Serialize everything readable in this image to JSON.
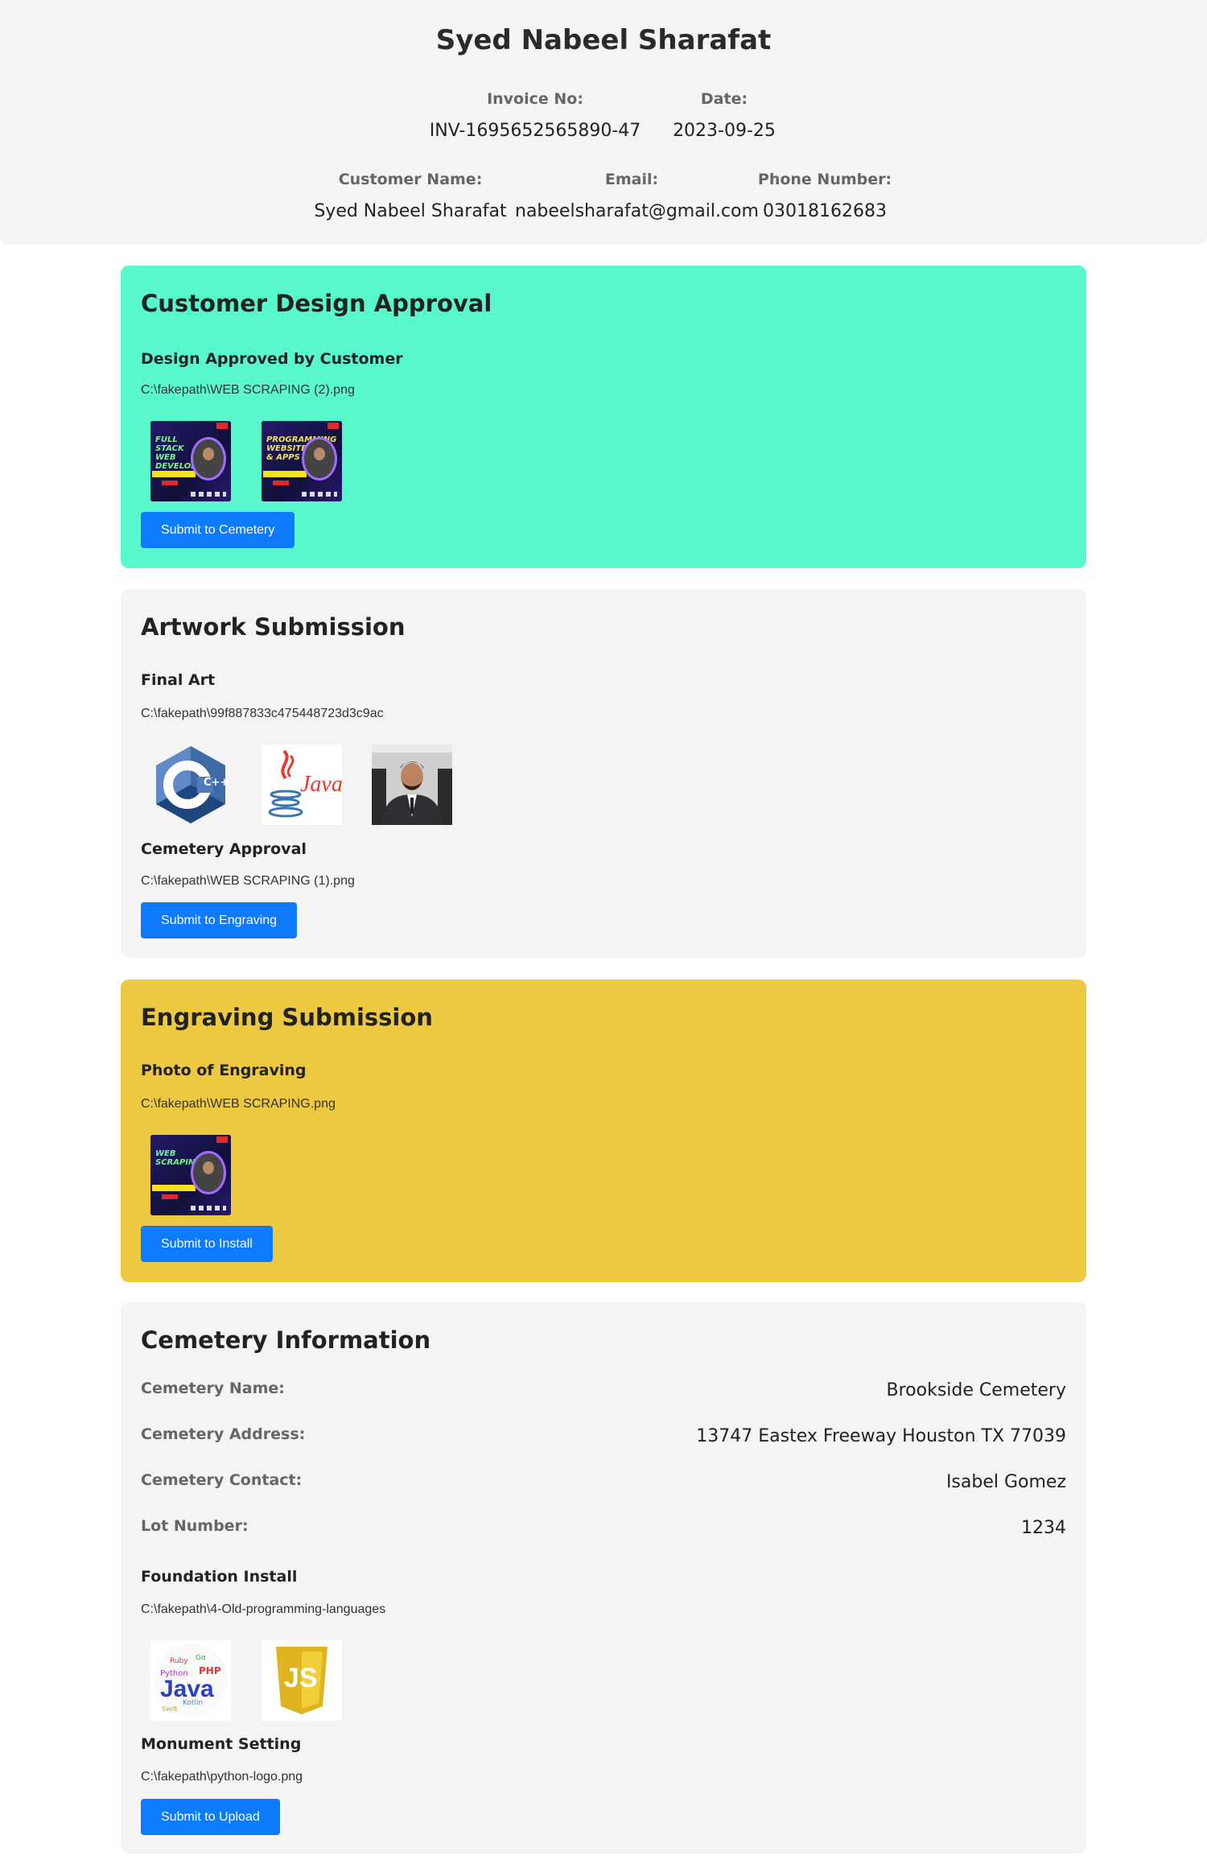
{
  "header": {
    "title": "Syed Nabeel Sharafat",
    "invoice_label": "Invoice No:",
    "invoice_value": "INV-1695652565890-47",
    "date_label": "Date:",
    "date_value": "2023-09-25",
    "customer_label": "Customer Name:",
    "customer_value": "Syed Nabeel Sharafat",
    "email_label": "Email:",
    "email_value": "nabeelsharafat@gmail.com",
    "phone_label": "Phone Number:",
    "phone_value": "03018162683"
  },
  "design_approval": {
    "title": "Customer Design Approval",
    "subtitle": "Design Approved by Customer",
    "file": "C:\\fakepath\\WEB SCRAPING (2).png",
    "thumb1_text": "FULL STACK WEB DEVELOPMENT",
    "thumb2_text": "PROGRAMMING WEBSITES & APPS",
    "button": "Submit to Cemetery",
    "bg": "#58f8cc"
  },
  "artwork": {
    "title": "Artwork Submission",
    "final_art_label": "Final Art",
    "final_art_file": "C:\\fakepath\\99f887833c475448723d3c9ac",
    "cpp_logo_text": "C++",
    "java_logo_text": "Java",
    "cemetery_approval_label": "Cemetery Approval",
    "cemetery_approval_file": "C:\\fakepath\\WEB SCRAPING (1).png",
    "button": "Submit to Engraving"
  },
  "engraving": {
    "title": "Engraving Submission",
    "photo_label": "Photo of Engraving",
    "file": "C:\\fakepath\\WEB SCRAPING.png",
    "thumb_text": "WEB SCRAPING",
    "button": "Submit to Install",
    "bg": "#edc841"
  },
  "cemetery": {
    "title": "Cemetery Information",
    "rows": [
      {
        "label": "Cemetery Name:",
        "value": "Brookside Cemetery"
      },
      {
        "label": "Cemetery Address:",
        "value": "13747 Eastex Freeway Houston TX 77039"
      },
      {
        "label": "Cemetery Contact:",
        "value": "Isabel Gomez"
      },
      {
        "label": "Lot Number:",
        "value": "1234"
      }
    ],
    "foundation_label": "Foundation Install",
    "foundation_file": "C:\\fakepath\\4-Old-programming-languages",
    "java_cloud_text": "Java",
    "js_logo_text": "JS",
    "monument_label": "Monument Setting",
    "monument_file": "C:\\fakepath\\python-logo.png",
    "button": "Submit to Upload"
  },
  "colors": {
    "button": "#0d7bff",
    "card_bg": "#f4f4f4"
  }
}
